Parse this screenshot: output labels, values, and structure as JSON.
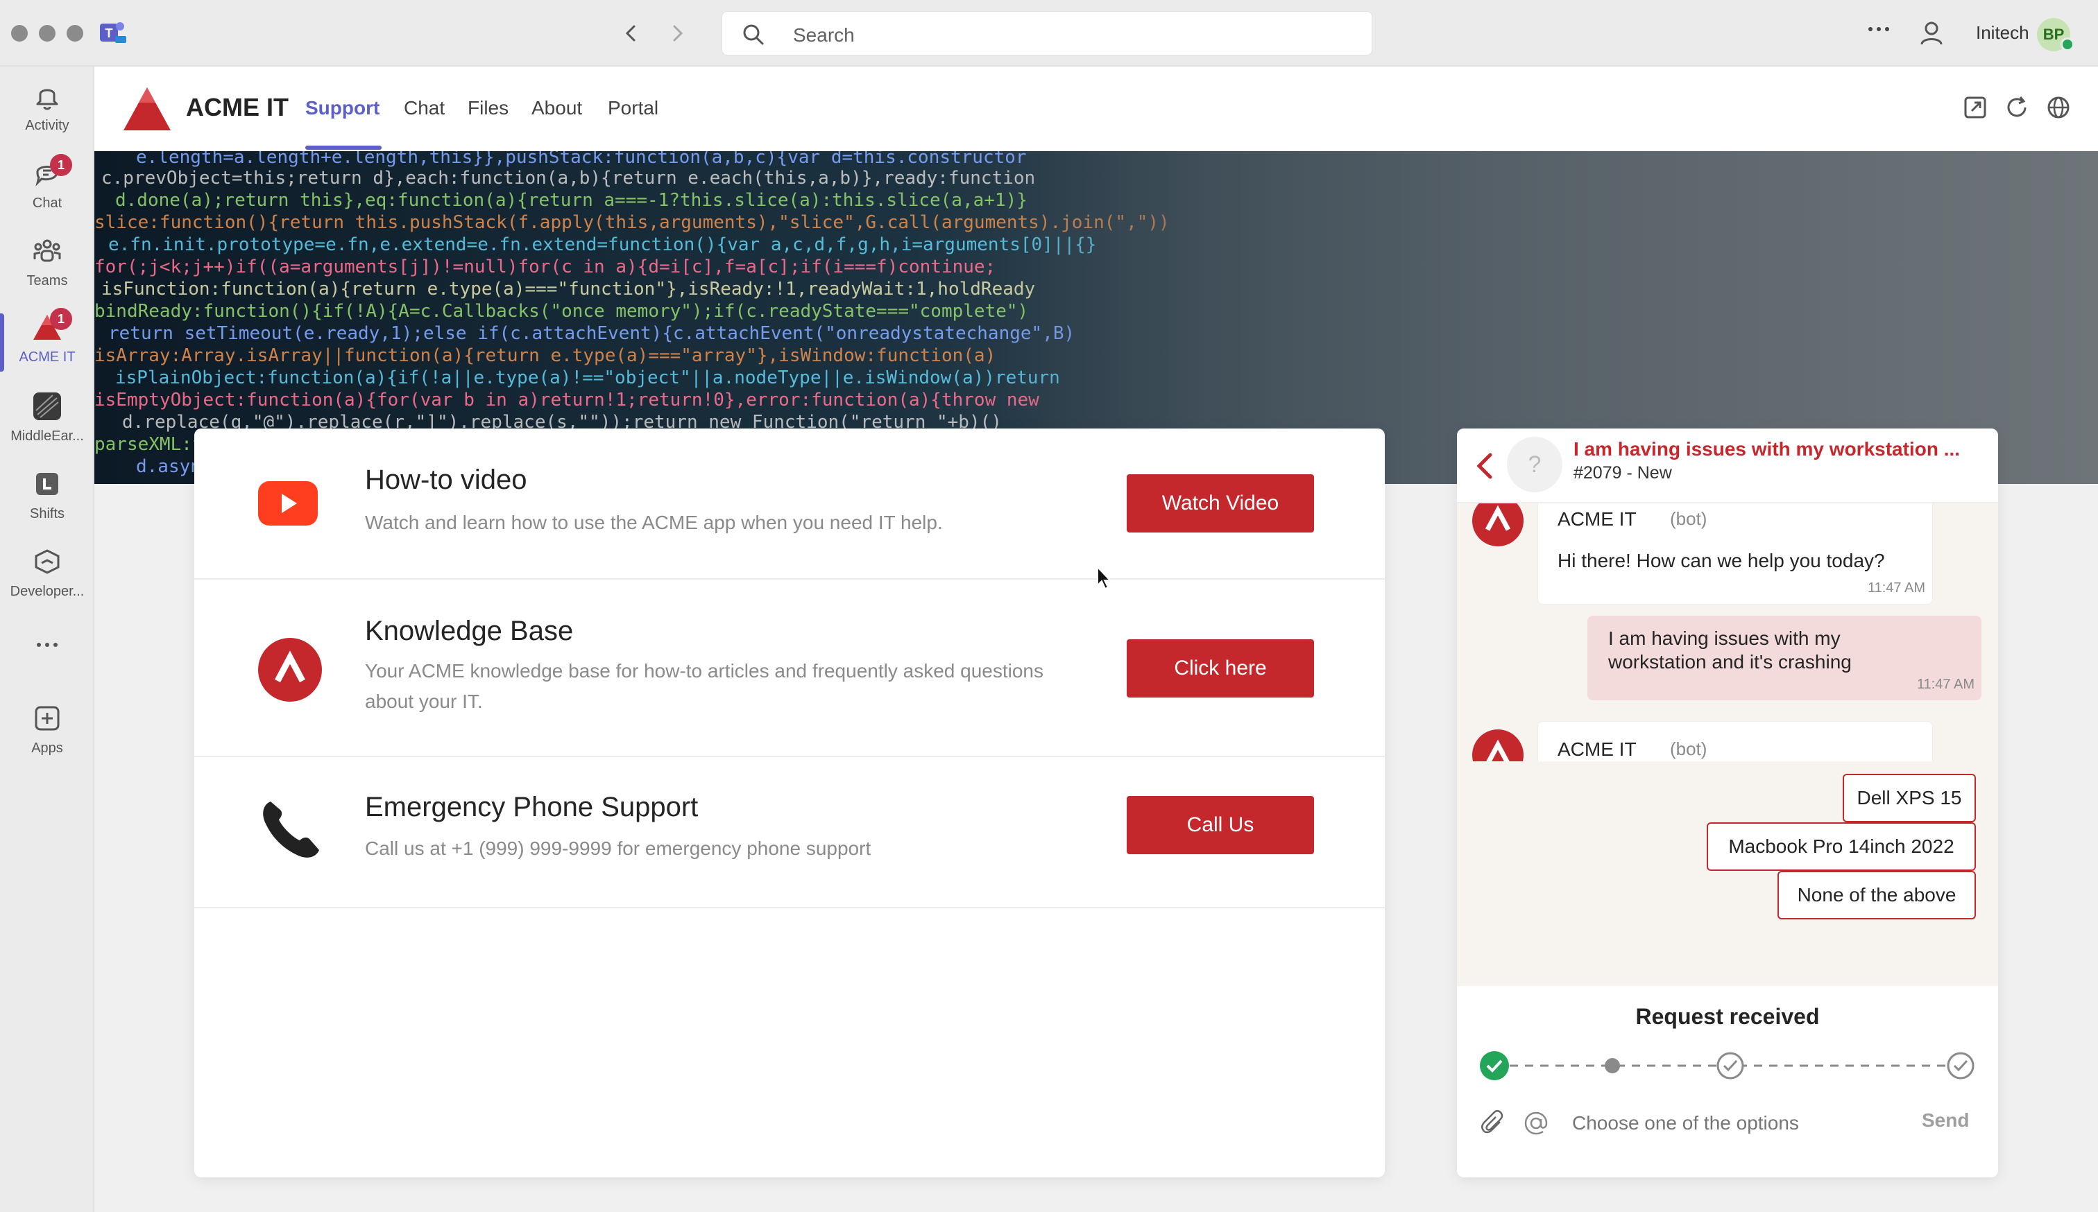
{
  "window": {
    "search_placeholder": "Search",
    "org_name": "Initech",
    "avatar_initials": "BP"
  },
  "rail": {
    "items": [
      {
        "label": "Activity",
        "icon": "bell-icon"
      },
      {
        "label": "Chat",
        "icon": "chat-icon",
        "badge": "1"
      },
      {
        "label": "Teams",
        "icon": "teams-icon"
      },
      {
        "label": "ACME IT",
        "icon": "acme-icon",
        "badge": "1",
        "active": true
      },
      {
        "label": "MiddleEar...",
        "icon": "middleearth-icon"
      },
      {
        "label": "Shifts",
        "icon": "shifts-icon"
      },
      {
        "label": "Developer...",
        "icon": "developer-icon"
      },
      {
        "label": "Apps",
        "icon": "apps-icon"
      }
    ]
  },
  "app": {
    "name": "ACME IT",
    "tabs": [
      "Support",
      "Chat",
      "Files",
      "About",
      "Portal"
    ],
    "active_tab": "Support"
  },
  "support": {
    "rows": [
      {
        "title": "How-to video",
        "description": "Watch and learn how to use the ACME app when you need IT help.",
        "button": "Watch Video",
        "icon": "youtube-icon"
      },
      {
        "title": "Knowledge Base",
        "description": "Your ACME knowledge base for how-to articles and frequently asked questions about your IT.",
        "button": "Click here",
        "icon": "acme-logo-icon"
      },
      {
        "title": "Emergency Phone Support",
        "description": "Call us at +1 (999) 999-9999 for emergency phone support",
        "button": "Call Us",
        "icon": "phone-icon"
      }
    ]
  },
  "chat": {
    "title": "I am having issues with my workstation ...",
    "ticket": "#2079 - New",
    "bot_name": "ACME IT",
    "bot_tag": "(bot)",
    "messages": [
      {
        "from": "bot",
        "text": "Hi there! How can we help you today?",
        "time": "11:47 AM"
      },
      {
        "from": "user",
        "text": "I am having issues with my workstation and it's crashing",
        "time": "11:47 AM"
      }
    ],
    "options": [
      "Dell XPS 15",
      "Macbook Pro 14inch 2022",
      "None of the above"
    ],
    "status": "Request received",
    "compose_placeholder": "Choose one of the options",
    "send_label": "Send"
  },
  "colors": {
    "accent": "#5b5fc7",
    "brand_red": "#c4282d",
    "badge_red": "#c4314b"
  }
}
